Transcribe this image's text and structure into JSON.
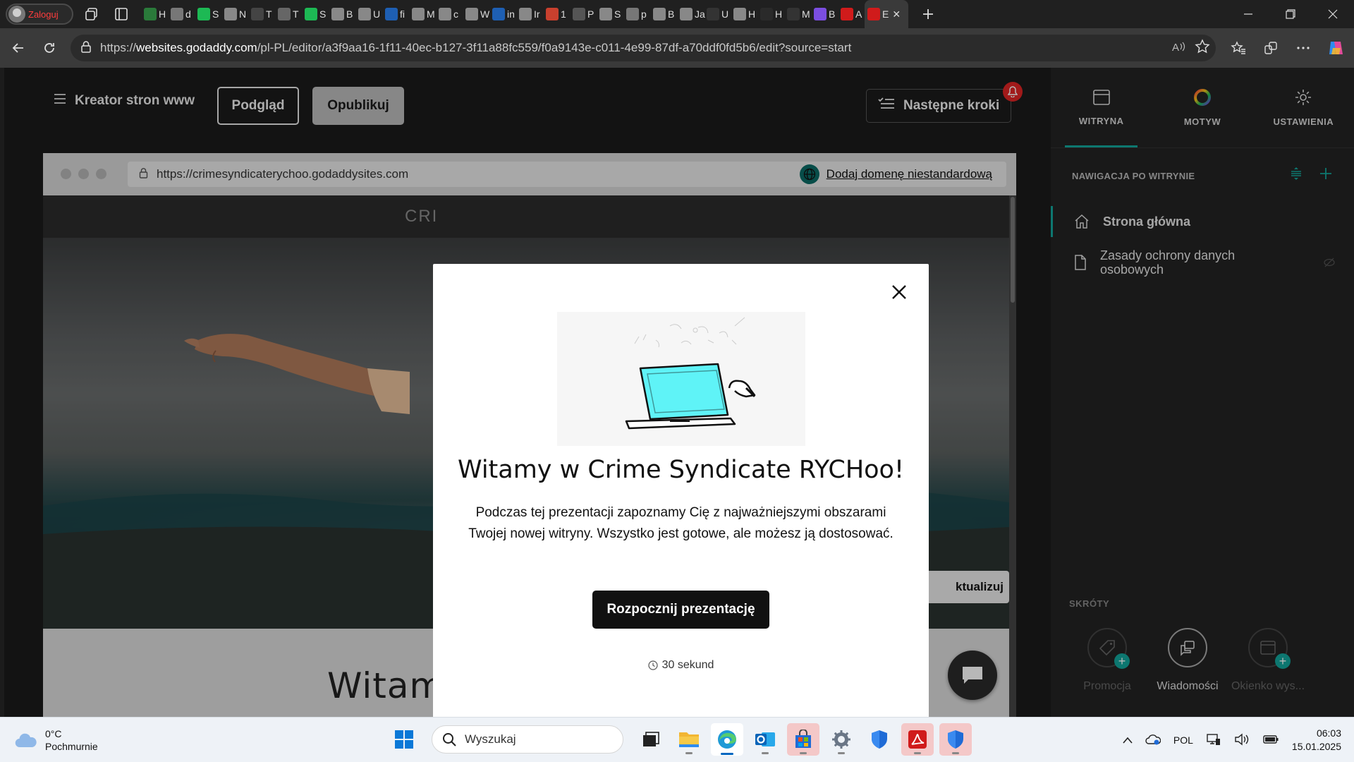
{
  "browser": {
    "profile_label": "Zaloguj",
    "tabs": [
      {
        "label": "H",
        "color": "#2a7a3a"
      },
      {
        "label": "d",
        "color": "#777"
      },
      {
        "label": "S",
        "color": "#1db954"
      },
      {
        "label": "N",
        "color": "#888"
      },
      {
        "label": "T",
        "color": "#444"
      },
      {
        "label": "T",
        "color": "#666"
      },
      {
        "label": "S",
        "color": "#1db954"
      },
      {
        "label": "B",
        "color": "#888"
      },
      {
        "label": "U",
        "color": "#888"
      },
      {
        "label": "fi",
        "color": "#1e5fb3"
      },
      {
        "label": "M",
        "color": "#888"
      },
      {
        "label": "c",
        "color": "#888"
      },
      {
        "label": "W",
        "color": "#888"
      },
      {
        "label": "in",
        "color": "#1e5fb3"
      },
      {
        "label": "Ir",
        "color": "#888"
      },
      {
        "label": "1",
        "color": "#c8402e"
      },
      {
        "label": "P",
        "color": "#555"
      },
      {
        "label": "S",
        "color": "#888"
      },
      {
        "label": "p",
        "color": "#777"
      },
      {
        "label": "B",
        "color": "#888"
      },
      {
        "label": "Ja",
        "color": "#888"
      },
      {
        "label": "U",
        "color": "#333"
      },
      {
        "label": "H",
        "color": "#888"
      },
      {
        "label": "H",
        "color": "#2a2a2a"
      },
      {
        "label": "M",
        "color": "#333"
      },
      {
        "label": "B",
        "color": "#7b4ee0"
      },
      {
        "label": "A",
        "color": "#d01b1b"
      }
    ],
    "active_tab_label": "E",
    "url_prefix": "https://",
    "url_host": "websites.godaddy.com",
    "url_path": "/pl-PL/editor/a3f9aa16-1f11-40ec-b127-3f11a88fc559/f0a9143e-c011-4e99-87df-a70ddf0fd5b6/edit?source=start"
  },
  "editor": {
    "menu_label": "Kreator stron www",
    "preview_button": "Podgląd",
    "publish_button": "Opublikuj",
    "next_steps_button": "Następne kroki",
    "preview_frame": {
      "url": "https://crimesyndicaterychoo.godaddysites.com",
      "add_domain_link": "Dodaj domenę niestandardową",
      "site_logo_partial": "CRI",
      "update_button_partial": "ktualizuj",
      "site_heading": "Witamy w usłudze Crime"
    },
    "panel": {
      "tabs": [
        {
          "label": "WITRYNA",
          "icon": "browser-window-icon",
          "active": true
        },
        {
          "label": "MOTYW",
          "icon": "color-wheel-icon",
          "active": false
        },
        {
          "label": "USTAWIENIA",
          "icon": "gear-icon",
          "active": false
        }
      ],
      "nav_header": "NAWIGACJA PO WITRYNIE",
      "pages": [
        {
          "label": "Strona główna",
          "icon": "home-icon",
          "active": true
        },
        {
          "label": "Zasady ochrony danych osobowych",
          "icon": "page-icon",
          "hidden": true
        }
      ],
      "shortcuts_header": "SKRÓTY",
      "shortcuts": [
        {
          "label": "Promocja",
          "icon": "tag-icon",
          "enabled": false
        },
        {
          "label": "Wiadomości",
          "icon": "messages-icon",
          "enabled": true
        },
        {
          "label": "Okienko wys...",
          "icon": "popup-window-icon",
          "enabled": false
        }
      ]
    }
  },
  "modal": {
    "title": "Witamy w Crime Syndicate RYCHoo!",
    "description": "Podczas tej prezentacji zapoznamy Cię z najważniejszymi obszarami Twojej nowej witryny. Wszystko jest gotowe, ale możesz ją dostosować.",
    "cta": "Rozpocznij prezentację",
    "duration": "30 sekund"
  },
  "taskbar": {
    "temperature": "0°C",
    "weather": "Pochmurnie",
    "search_placeholder": "Wyszukaj",
    "language": "POL",
    "time": "06:03",
    "date": "15.01.2025"
  },
  "colors": {
    "accent": "#12a59b",
    "notification": "#e02424",
    "profile_text": "#ff3d3d"
  }
}
